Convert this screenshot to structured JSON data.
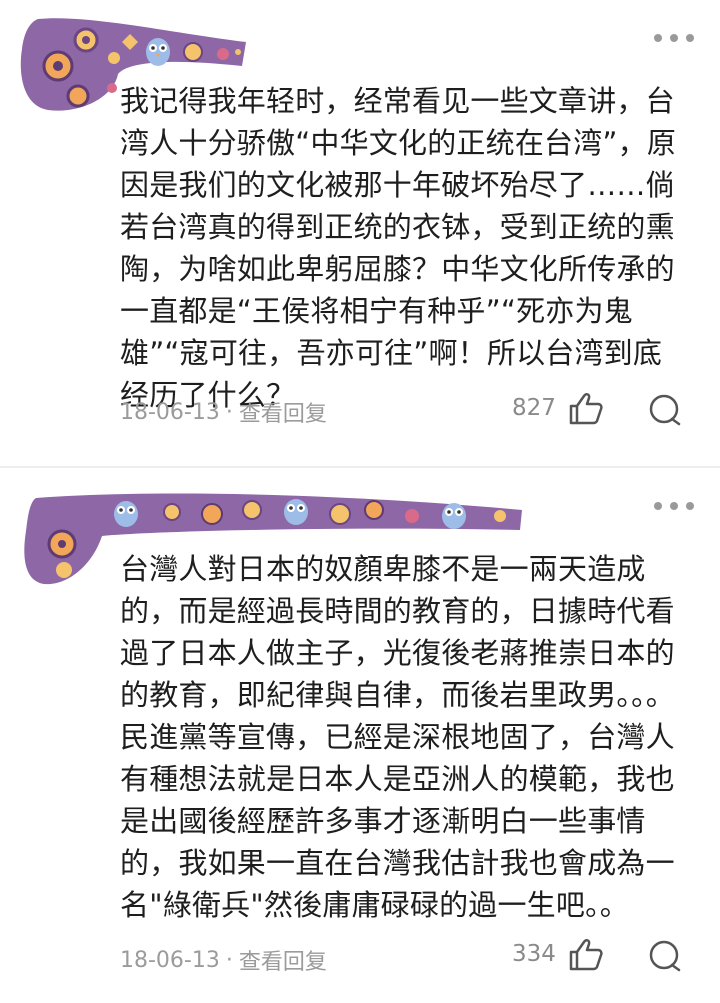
{
  "comments": [
    {
      "text": "我记得我年轻时，经常看见一些文章讲，台湾人十分骄傲“中华文化的正统在台湾”，原因是我们的文化被那十年破坏殆尽了……倘若台湾真的得到正统的衣钵，受到正统的熏陶，为啥如此卑躬屈膝？中华文化所传承的一直都是“王侯将相宁有种乎”“死亦为鬼雄”“寇可往，吾亦可往”啊！所以台湾到底经历了什么？",
      "date": "18-06-13",
      "separator": "·",
      "reply_label": "查看回复",
      "likes": "827",
      "avatar_icon": "purple-owl-pattern-banner",
      "banner_color": "#8e67a6"
    },
    {
      "text": "台灣人對日本的奴顏卑膝不是一兩天造成的，而是經過長時間的教育的，日據時代看過了日本人做主子，光復後老蔣推崇日本的的教育，即紀律與自律，而後岩里政男。。。民進黨等宣傳，已經是深根地固了，台灣人有種想法就是日本人是亞洲人的模範，我也是出國後經歷許多事才逐漸明白一些事情的，我如果一直在台灣我估計我也會成為一名\"綠衛兵\"然後庸庸碌碌的過一生吧。。",
      "date": "18-06-13",
      "separator": "·",
      "reply_label": "查看回复",
      "likes": "334",
      "avatar_icon": "purple-owl-pattern-banner",
      "banner_color": "#8e67a6"
    }
  ],
  "icons": {
    "more": "more-dots-icon",
    "like": "thumbs-up-icon",
    "comment": "comment-bubble-icon"
  }
}
